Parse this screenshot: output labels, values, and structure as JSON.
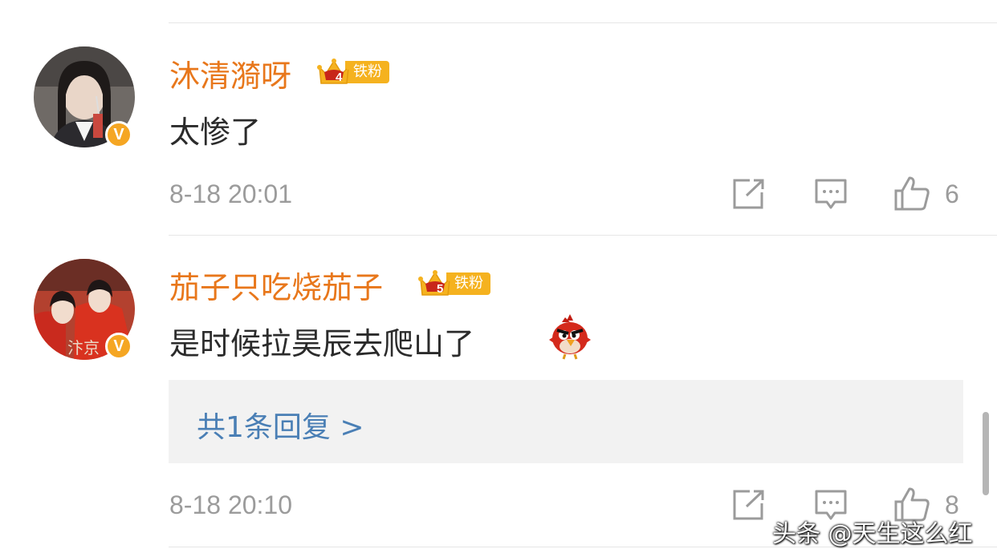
{
  "comments": [
    {
      "username": "沐清漪呀",
      "fan_level": "4",
      "fan_label": "铁粉",
      "text": "太惨了",
      "timestamp": "8-18 20:01",
      "likes": "6",
      "verified_mark": "V"
    },
    {
      "username": "茄子只吃烧茄子",
      "fan_level": "5",
      "fan_label": "铁粉",
      "text": "是时候拉昊辰去爬山了",
      "emoji": "angry-bird-red-emoji",
      "timestamp": "8-18 20:10",
      "likes": "8",
      "verified_mark": "V",
      "reply_link": "共1条回复 >"
    }
  ],
  "icons": {
    "share": "share-icon",
    "comment": "comment-icon",
    "like": "like-icon"
  },
  "colors": {
    "username": "#e8771b",
    "badge": "#f5a623",
    "reply_link": "#4a7fb5",
    "meta_text": "#9b9b9b"
  },
  "watermark": "头条 @天生这么红"
}
